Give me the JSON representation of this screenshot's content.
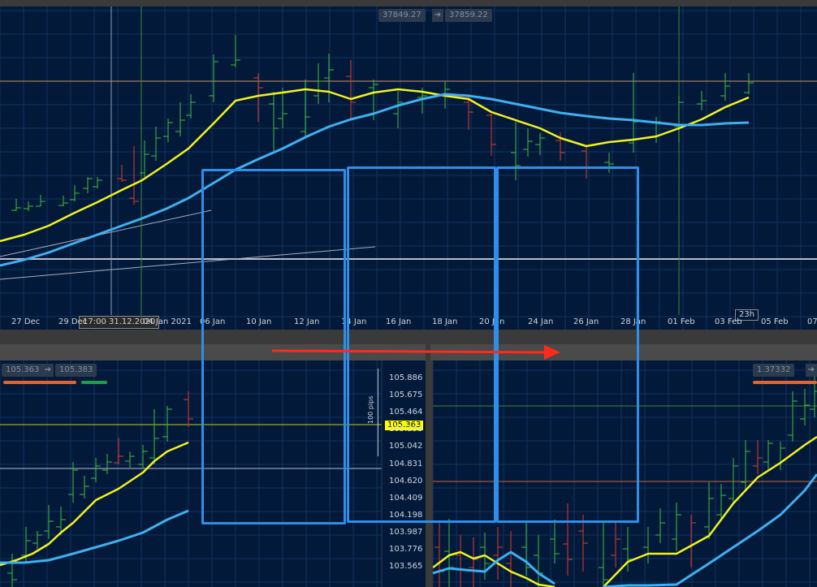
{
  "top_chart": {
    "bid_price": "37849.27",
    "ask_price": "37859.22",
    "arrow_glyph": "➔",
    "crosshair_time_label": "17:00 31.12.2020",
    "countdown": "23h",
    "x_ticks": [
      "27 Dec",
      "29 Dec",
      "04 Jan 2021",
      "06 Jan",
      "10 Jan",
      "12 Jan",
      "14 Jan",
      "16 Jan",
      "18 Jan",
      "20 Jan",
      "24 Jan",
      "26 Jan",
      "28 Jan",
      "01 Feb",
      "03 Feb",
      "05 Feb",
      "07"
    ]
  },
  "bottom_left_chart": {
    "bid_price": "105.363",
    "ask_price": "105.383",
    "arrow_glyph": "➔",
    "pips_label": "100 pips",
    "current_price_tag": "105.363",
    "y_ticks": [
      "105.886",
      "105.675",
      "105.464",
      "105.253",
      "105.042",
      "104.831",
      "104.620",
      "104.409",
      "104.198",
      "103.987",
      "103.776",
      "103.565"
    ]
  },
  "bottom_right_chart": {
    "bid_price": "1.37332"
  },
  "colors": {
    "background": "#03193a",
    "grid": "#12325e",
    "bull_candle": "#3fbf3f",
    "bear_candle": "#e03a2a",
    "fast_ma": "#f2f21e",
    "slow_ma": "#3fb0ef",
    "overlay_box": "#2f8fe8",
    "red_arrow": "#ff2a1a"
  },
  "icons": {
    "arrow": "right-arrow-icon"
  }
}
